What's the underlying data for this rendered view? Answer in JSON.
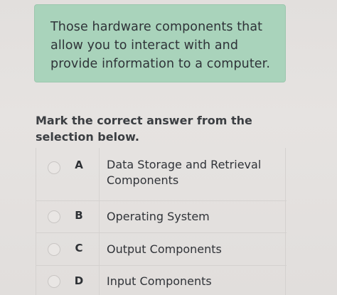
{
  "question": {
    "text": "Those hardware components that allow you to interact with and provide information to a computer."
  },
  "instruction": "Mark the correct answer from the selection below.",
  "options": [
    {
      "letter": "A",
      "label": "Data Storage and Retrieval Components",
      "selected": false
    },
    {
      "letter": "B",
      "label": "Operating System",
      "selected": false
    },
    {
      "letter": "C",
      "label": "Output Components",
      "selected": false
    },
    {
      "letter": "D",
      "label": "Input Components",
      "selected": false
    }
  ],
  "colors": {
    "question_bg": "#a9d3bb",
    "page_bg": "#e4e1df",
    "text": "#303338"
  }
}
